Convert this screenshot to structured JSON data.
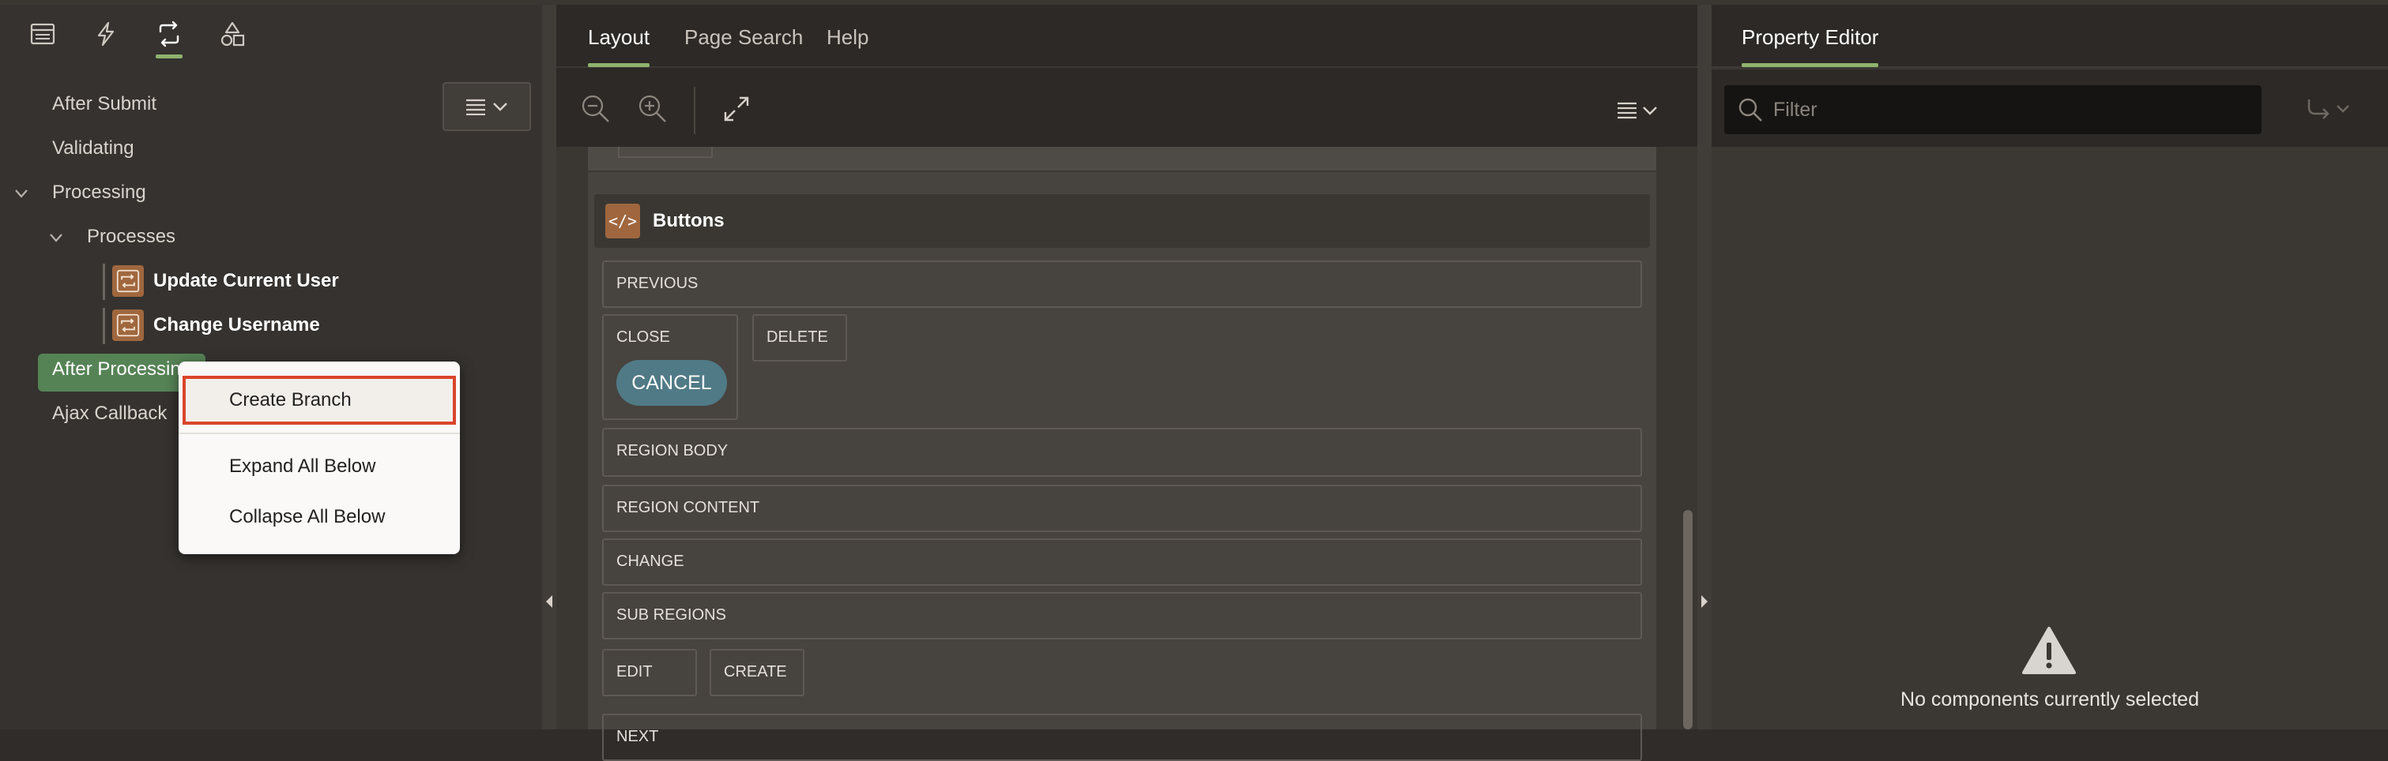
{
  "left_panel": {
    "tabs": [
      {
        "icon": "rendering-icon"
      },
      {
        "icon": "dynamic-actions-icon"
      },
      {
        "icon": "processing-icon",
        "active": true
      },
      {
        "icon": "shared-components-icon"
      }
    ],
    "menu_icon": "hamburger-menu-icon",
    "tree": {
      "after_submit": "After Submit",
      "validating": "Validating",
      "processing": "Processing",
      "processes": "Processes",
      "update_current_user": "Update Current User",
      "change_username": "Change Username",
      "after_processing": "After Processing",
      "ajax_callback": "Ajax Callback"
    }
  },
  "context_menu": {
    "create_branch": "Create Branch",
    "expand_all_below": "Expand All Below",
    "collapse_all_below": "Collapse All Below"
  },
  "center_panel": {
    "tabs": {
      "layout": "Layout",
      "page_search": "Page Search",
      "help": "Help"
    },
    "region": {
      "title": "Buttons",
      "icon_text": "</>"
    },
    "slots": {
      "previous": "PREVIOUS",
      "close": "CLOSE",
      "cancel": "CANCEL",
      "delete": "DELETE",
      "region_body": "REGION BODY",
      "region_content": "REGION CONTENT",
      "change": "CHANGE",
      "sub_regions": "SUB REGIONS",
      "edit": "EDIT",
      "create": "CREATE",
      "next": "NEXT"
    }
  },
  "right_panel": {
    "tab": "Property Editor",
    "filter_placeholder": "Filter",
    "empty_message": "No components currently selected"
  },
  "colors": {
    "accent_green": "#8fb36f",
    "selected_row": "#568356",
    "highlight_border": "#d9452b",
    "cancel_button": "#507a86",
    "component_icon": "#a0673e"
  }
}
